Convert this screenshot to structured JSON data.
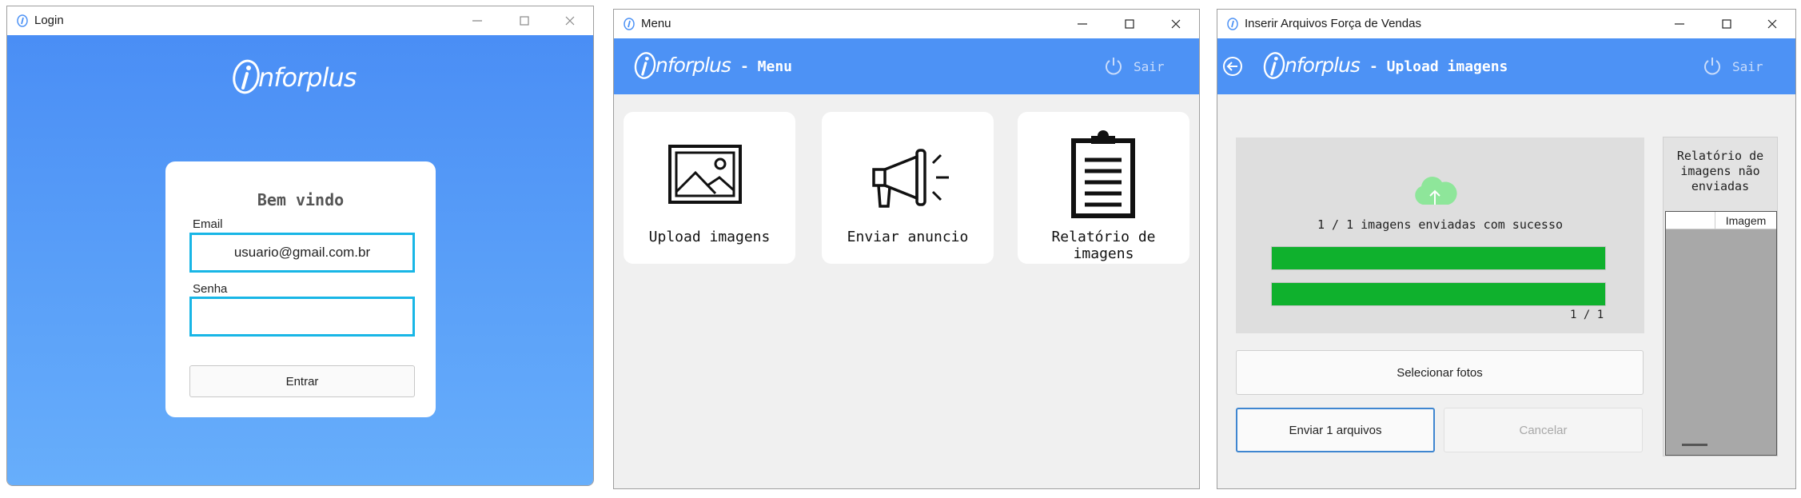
{
  "login": {
    "window_title": "Login",
    "brand": "nforplus",
    "welcome": "Bem vindo",
    "email_label": "Email",
    "email_value": "usuario@gmail.com.br",
    "password_label": "Senha",
    "password_value": "",
    "submit_label": "Entrar"
  },
  "menu": {
    "window_title": "Menu",
    "brand": "nforplus",
    "header_suffix": "- Menu",
    "logout_label": "Sair",
    "tiles": [
      {
        "label": "Upload imagens",
        "icon": "image-icon"
      },
      {
        "label": "Enviar anuncio",
        "icon": "megaphone-icon"
      },
      {
        "label": "Relatório de imagens",
        "icon": "clipboard-icon"
      }
    ]
  },
  "upload": {
    "window_title": "Inserir Arquivos Força de Vendas",
    "brand": "nforplus",
    "header_suffix": "- Upload imagens",
    "logout_label": "Sair",
    "status_text": "1 / 1 imagens enviadas com sucesso",
    "progress_1": 1.0,
    "progress_2": 1.0,
    "count_text": "1 / 1",
    "select_label": "Selecionar fotos",
    "send_label": "Enviar 1 arquivos",
    "cancel_label": "Cancelar",
    "side_title": "Relatório de imagens não enviadas",
    "grid_header": "Imagem"
  },
  "colors": {
    "brand_blue": "#4d92f5",
    "focus_cyan": "#18b6e6",
    "progress_green": "#0fb12d",
    "cloud_green": "#8ee69a"
  }
}
